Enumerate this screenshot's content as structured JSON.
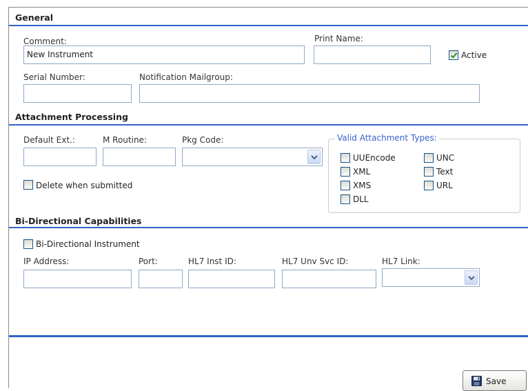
{
  "sections": {
    "general": "General",
    "attachment": "Attachment Processing",
    "bidirectional": "Bi-Directional Capabilities"
  },
  "general": {
    "comment_label": "Comment:",
    "comment_value": "New Instrument",
    "print_name_label": "Print Name:",
    "print_name_value": "",
    "active_label": "Active",
    "active_checked": true,
    "serial_label": "Serial Number:",
    "serial_value": "",
    "mailgroup_label": "Notification Mailgroup:",
    "mailgroup_value": ""
  },
  "attachment": {
    "default_ext_label": "Default Ext.:",
    "m_routine_label": "M Routine:",
    "pkg_code_label": "Pkg Code:",
    "delete_label": "Delete when submitted",
    "types_legend": "Valid Attachment Types:",
    "types": {
      "uuencode": "UUEncode",
      "unc": "UNC",
      "xml": "XML",
      "text": "Text",
      "xms": "XMS",
      "url": "URL",
      "dll": "DLL"
    }
  },
  "bidirectional": {
    "instrument_label": "Bi-Directional Instrument",
    "ip_label": "IP Address:",
    "port_label": "Port:",
    "hl7_inst_label": "HL7 Inst ID:",
    "hl7_unv_label": "HL7 Unv Svc ID:",
    "hl7_link_label": "HL7 Link:"
  },
  "footer": {
    "save_label": "Save"
  },
  "colors": {
    "accent_rule": "#2f64c6",
    "legend_text": "#3b5fd0",
    "input_border": "#8fa7c8"
  }
}
